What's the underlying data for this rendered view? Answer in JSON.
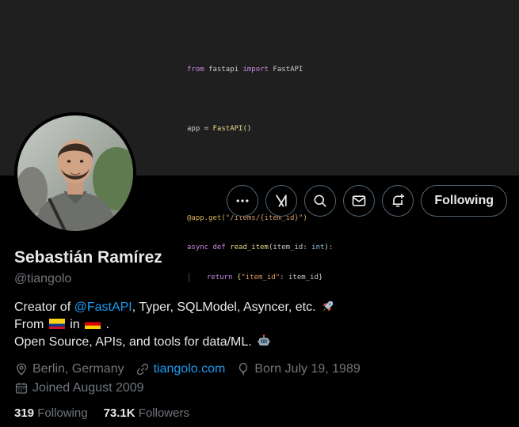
{
  "banner": {
    "code": {
      "line1_kw1": "from",
      "line1_mod": " fastapi ",
      "line1_kw2": "import",
      "line1_cls": " FastAPI",
      "line2_var": "app = ",
      "line2_call": "FastAPI()",
      "line3_dec": "@app.get(",
      "line3_str": "\"/items/{item_id}\"",
      "line3_end": ")",
      "line4_kw1": "async def ",
      "line4_fn": "read_item",
      "line4_param": "(item_id: ",
      "line4_type": "int",
      "line4_end": "):",
      "line5_kw": "return ",
      "line5_open": "{",
      "line5_key": "\"item_id\"",
      "line5_rest": ": item_id}"
    }
  },
  "actions": {
    "following_label": "Following"
  },
  "profile": {
    "name": "Sebastián Ramírez",
    "handle": "@tiangolo"
  },
  "bio": {
    "line1_prefix": "Creator of ",
    "line1_link": "@FastAPI",
    "line1_rest": ", Typer, SQLModel, Asyncer, etc.",
    "line2_from": "From",
    "line2_in": "in",
    "line2_end": ".",
    "line3": "Open Source, APIs, and tools for data/ML."
  },
  "meta": {
    "location": "Berlin, Germany",
    "website": "tiangolo.com",
    "born": "Born July 19, 1989",
    "joined": "Joined August 2009"
  },
  "stats": {
    "following_count": "319",
    "following_label": "Following",
    "followers_count": "73.1K",
    "followers_label": "Followers"
  },
  "colors": {
    "background": "#000000",
    "link": "#1d9bf0",
    "secondary_text": "#71767b",
    "primary_text": "#e7e9ea",
    "border": "#536471"
  }
}
